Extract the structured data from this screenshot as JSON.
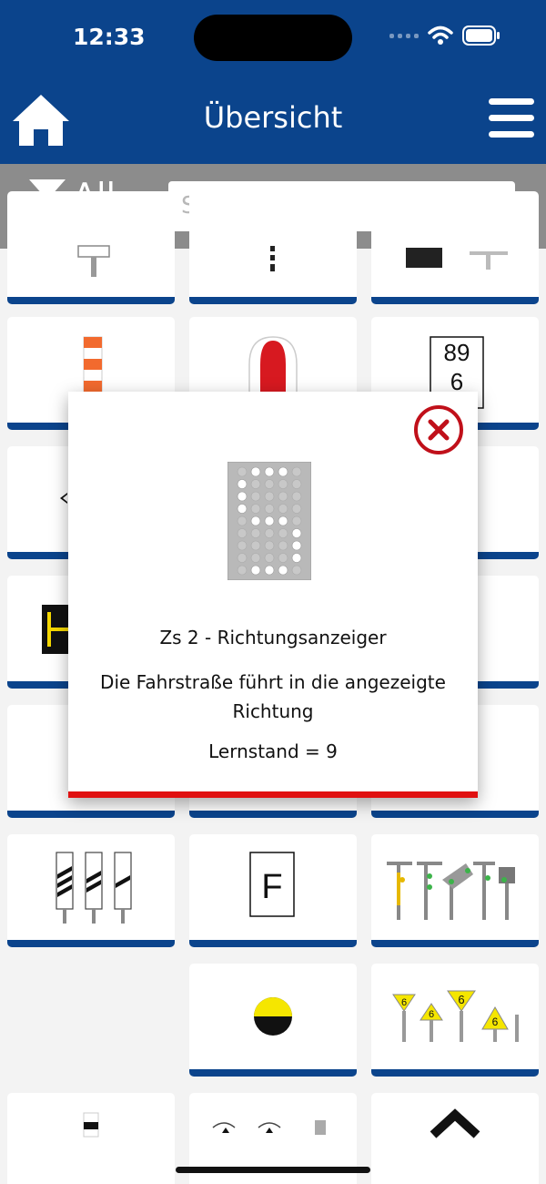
{
  "status_bar": {
    "time": "12:33"
  },
  "header": {
    "title": "Übersicht",
    "home_icon": "home-icon",
    "menu_icon": "hamburger-menu-icon"
  },
  "filter": {
    "label": "All",
    "icon": "filter-icon"
  },
  "search": {
    "placeholder": "Suche",
    "value": "",
    "clear_icon": "clear-circle-x-icon"
  },
  "colors": {
    "brand_blue": "#0b448c",
    "filter_gray": "#8c8c8c",
    "modal_accent": "#e01010",
    "close_red": "#c0101a"
  },
  "tiles": {
    "row5": [
      {
        "sign": "F"
      }
    ],
    "row6": [
      {
        "sign": "6"
      }
    ],
    "top_right": {
      "numbers": [
        "89",
        "6"
      ]
    }
  },
  "modal": {
    "title": "Zs 2 - Richtungsanzeiger",
    "description": "Die Fahrstraße führt in die angezeigte Richtung",
    "status": "Lernstand = 9",
    "close_icon": "close-circle-icon"
  }
}
